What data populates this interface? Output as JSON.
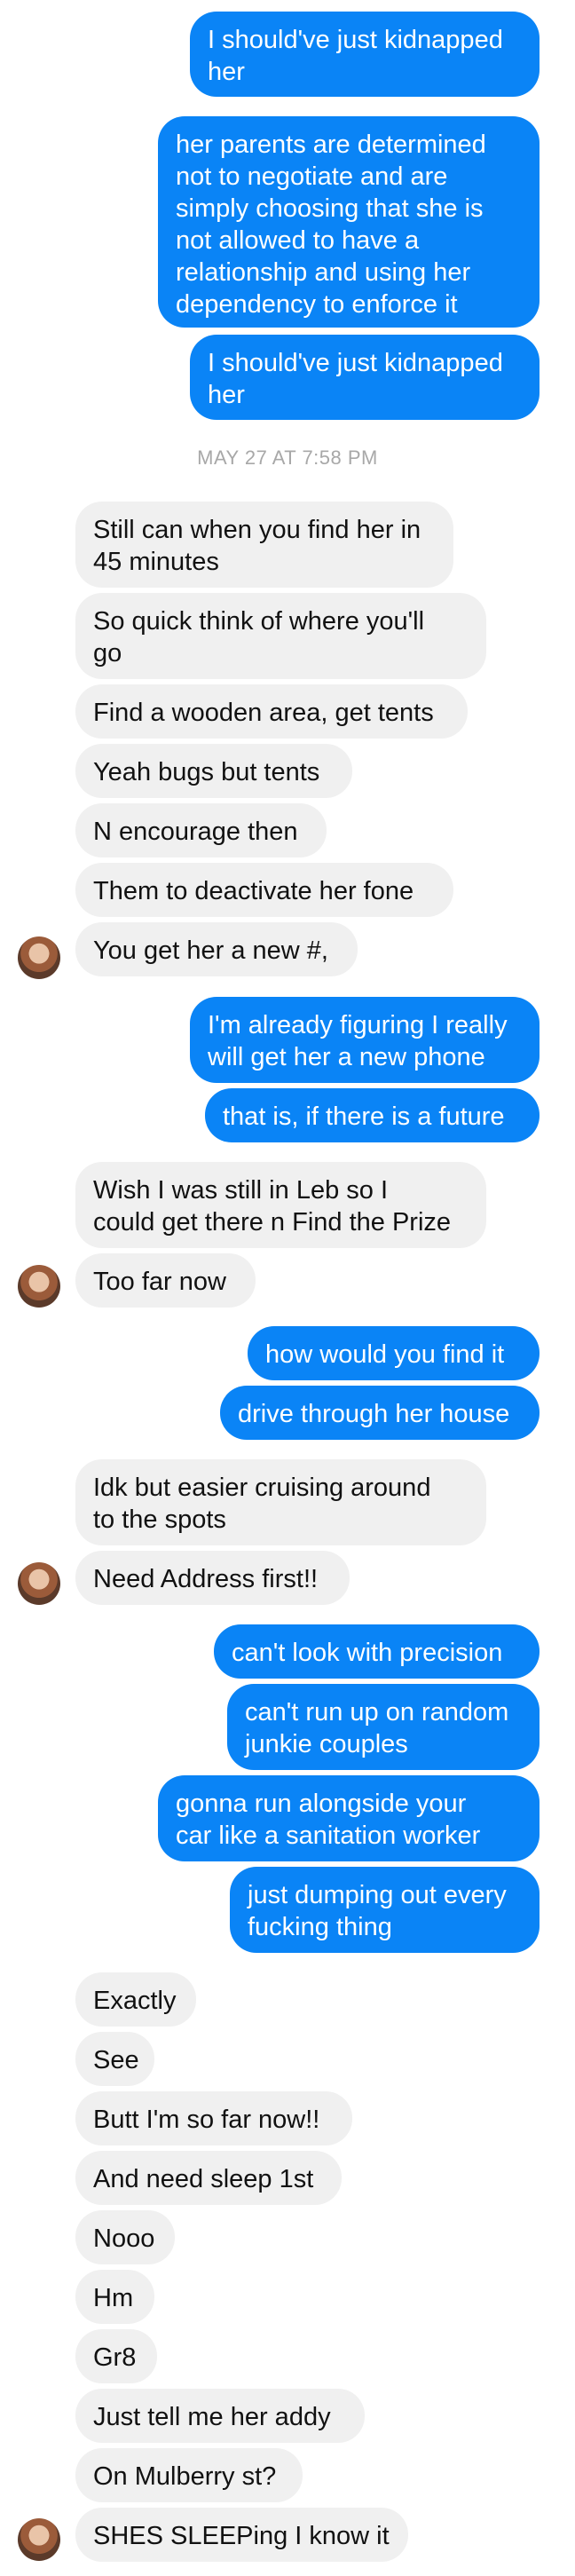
{
  "colors": {
    "outgoing_bubble": "#0a84f6",
    "incoming_bubble": "#f0f0f0",
    "timestamp": "#a8a8a8"
  },
  "timestamp": "MAY 27 AT 7:58 PM",
  "messages": [
    {
      "sender": "me",
      "text": "I should've just kidnapped\nher"
    },
    {
      "sender": "me",
      "text": "her parents are determined\nnot to negotiate and are\nsimply choosing that she is\nnot allowed to have a\nrelationship and using her\ndependency to enforce it"
    },
    {
      "sender": "me",
      "text": "I should've just kidnapped\nher"
    },
    {
      "sender": "them",
      "text": "Still can when you find her in\n45 minutes"
    },
    {
      "sender": "them",
      "text": "So quick think of where you'll\ngo"
    },
    {
      "sender": "them",
      "text": "Find a wooden area, get tents"
    },
    {
      "sender": "them",
      "text": "Yeah bugs but tents"
    },
    {
      "sender": "them",
      "text": "N encourage then"
    },
    {
      "sender": "them",
      "text": "Them to deactivate her fone"
    },
    {
      "sender": "them",
      "text": "You get her a new #,"
    },
    {
      "sender": "me",
      "text": "I'm already figuring I really\nwill get her a new phone"
    },
    {
      "sender": "me",
      "text": "that is, if there is a future"
    },
    {
      "sender": "them",
      "text": "Wish I was still in Leb so I\ncould get there n Find the Prize"
    },
    {
      "sender": "them",
      "text": "Too far now"
    },
    {
      "sender": "me",
      "text": "how would you find it"
    },
    {
      "sender": "me",
      "text": "drive through her house"
    },
    {
      "sender": "them",
      "text": "Idk but easier cruising around\nto the spots"
    },
    {
      "sender": "them",
      "text": "Need Address first!!"
    },
    {
      "sender": "me",
      "text": "can't look with precision"
    },
    {
      "sender": "me",
      "text": "can't run up on random\njunkie couples"
    },
    {
      "sender": "me",
      "text": "gonna run alongside your\ncar like a sanitation worker"
    },
    {
      "sender": "me",
      "text": "just dumping out every\nfucking thing"
    },
    {
      "sender": "them",
      "text": "Exactly"
    },
    {
      "sender": "them",
      "text": "See"
    },
    {
      "sender": "them",
      "text": "Butt I'm so far now!!"
    },
    {
      "sender": "them",
      "text": "And need sleep 1st"
    },
    {
      "sender": "them",
      "text": "Nooo"
    },
    {
      "sender": "them",
      "text": "Hm"
    },
    {
      "sender": "them",
      "text": "Gr8"
    },
    {
      "sender": "them",
      "text": "Just tell me her addy"
    },
    {
      "sender": "them",
      "text": "On Mulberry st?"
    },
    {
      "sender": "them",
      "text": "SHES SLEEPing I know it"
    }
  ]
}
